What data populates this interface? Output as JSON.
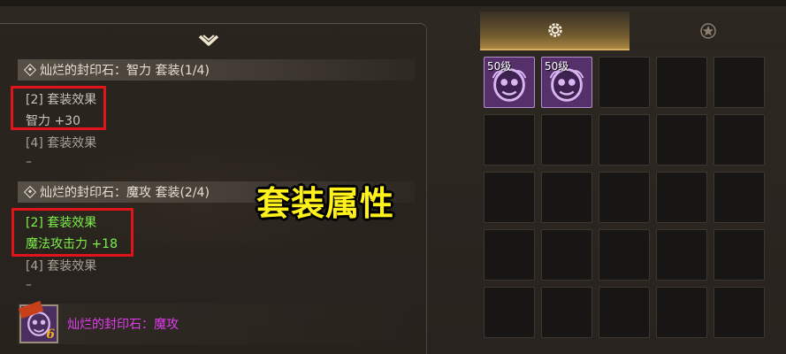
{
  "left_panel": {
    "sets": [
      {
        "header": "灿烂的封印石：智力 套装(1/4)",
        "effects": [
          {
            "title": "[2] 套装效果",
            "value": "智力 +30"
          },
          {
            "title": "[4] 套装效果",
            "value": "–"
          }
        ]
      },
      {
        "header": "灿烂的封印石：魔攻 套装(2/4)",
        "effects": [
          {
            "title": "[2] 套装效果",
            "value": "魔法攻击力 +18"
          },
          {
            "title": "[4] 套装效果",
            "value": "–"
          }
        ]
      }
    ],
    "item": {
      "name": "灿烂的封印石：魔攻",
      "level_badge": "6"
    }
  },
  "overlay_title": "套装属性",
  "tabs": [
    {
      "icon": "gear-icon",
      "active": true
    },
    {
      "icon": "star-icon",
      "active": false
    }
  ],
  "grid": {
    "slot_labels": [
      "50级",
      "50级"
    ]
  },
  "colors": {
    "active_effect": "#7df04a",
    "inactive_effect": "#a9a397",
    "item_name": "#e23cf0",
    "highlight_box": "#e0141a",
    "overlay_text": "#fff21a",
    "tab_active": "#c9a050"
  }
}
